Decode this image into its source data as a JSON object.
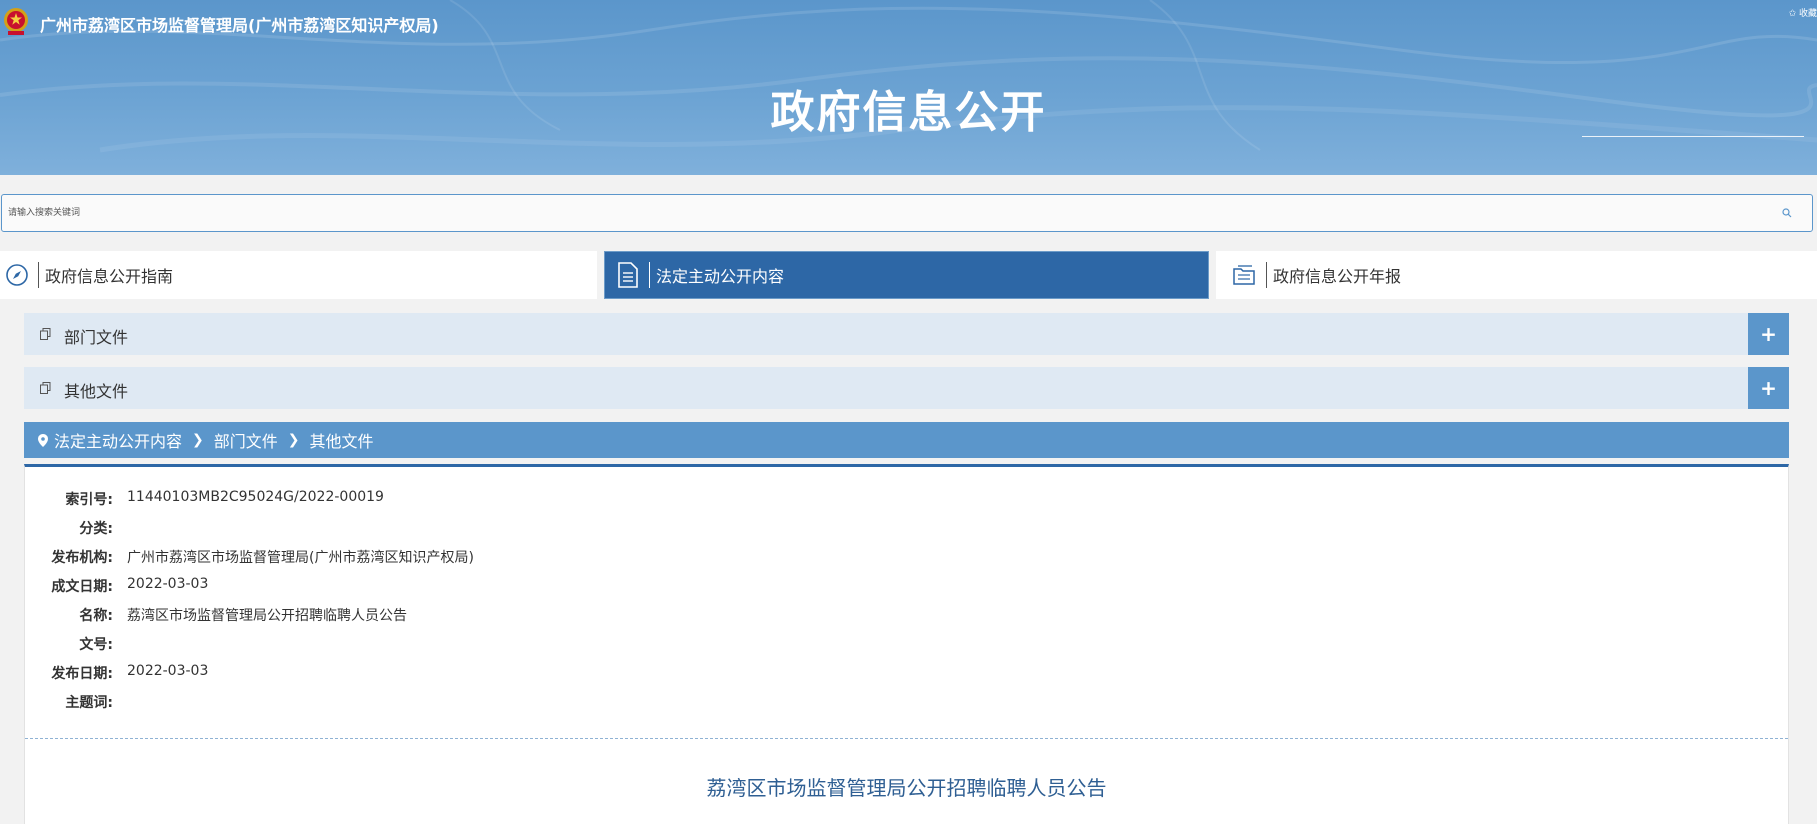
{
  "header": {
    "org_title": "广州市荔湾区市场监督管理局(广州市荔湾区知识产权局)",
    "favorite": "✩ 收藏",
    "page_title": "政府信息公开"
  },
  "search": {
    "placeholder": "请输入搜索关键词"
  },
  "tabs": [
    {
      "label": "政府信息公开指南",
      "icon": "compass-icon",
      "active": false
    },
    {
      "label": "法定主动公开内容",
      "icon": "document-icon",
      "active": true
    },
    {
      "label": "政府信息公开年报",
      "icon": "folder-icon",
      "active": false
    }
  ],
  "accordion": [
    {
      "label": "部门文件",
      "toggle": "+"
    },
    {
      "label": "其他文件",
      "toggle": "+"
    }
  ],
  "breadcrumb": {
    "items": [
      "法定主动公开内容",
      "部门文件",
      "其他文件"
    ],
    "separator": "❯"
  },
  "meta": [
    {
      "key": "索引号:",
      "value": "11440103MB2C95024G/2022-00019"
    },
    {
      "key": "分类:",
      "value": ""
    },
    {
      "key": "发布机构:",
      "value": "广州市荔湾区市场监督管理局(广州市荔湾区知识产权局)"
    },
    {
      "key": "成文日期:",
      "value": "2022-03-03"
    },
    {
      "key": "名称:",
      "value": "荔湾区市场监督管理局公开招聘临聘人员公告"
    },
    {
      "key": "文号:",
      "value": ""
    },
    {
      "key": "发布日期:",
      "value": "2022-03-03"
    },
    {
      "key": "主题词:",
      "value": ""
    }
  ],
  "document": {
    "title": "荔湾区市场监督管理局公开招聘临聘人员公告"
  },
  "colors": {
    "banner": "#5b96cb",
    "active_tab": "#2d67a6",
    "accordion_bg": "#dfe9f3",
    "doc_title": "#2f5f93"
  }
}
